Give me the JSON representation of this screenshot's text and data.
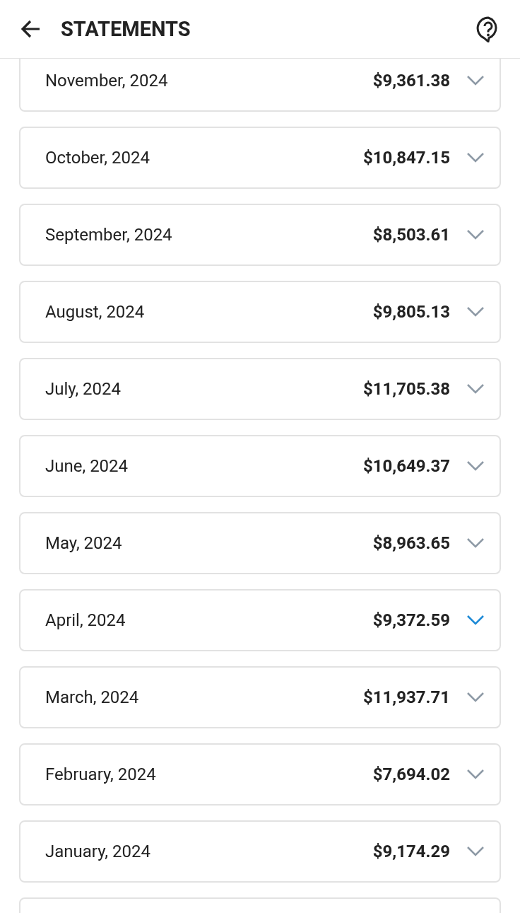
{
  "header": {
    "title": "STATEMENTS"
  },
  "statements": [
    {
      "month": "November, 2024",
      "amount": "$9,361.38",
      "selected": false
    },
    {
      "month": "October, 2024",
      "amount": "$10,847.15",
      "selected": false
    },
    {
      "month": "September, 2024",
      "amount": "$8,503.61",
      "selected": false
    },
    {
      "month": "August, 2024",
      "amount": "$9,805.13",
      "selected": false
    },
    {
      "month": "July, 2024",
      "amount": "$11,705.38",
      "selected": false
    },
    {
      "month": "June, 2024",
      "amount": "$10,649.37",
      "selected": false
    },
    {
      "month": "May, 2024",
      "amount": "$8,963.65",
      "selected": false
    },
    {
      "month": "April, 2024",
      "amount": "$9,372.59",
      "selected": true
    },
    {
      "month": "March, 2024",
      "amount": "$11,937.71",
      "selected": false
    },
    {
      "month": "February, 2024",
      "amount": "$7,694.02",
      "selected": false
    },
    {
      "month": "January, 2024",
      "amount": "$9,174.29",
      "selected": false
    }
  ],
  "next_card_partly_visible": true
}
